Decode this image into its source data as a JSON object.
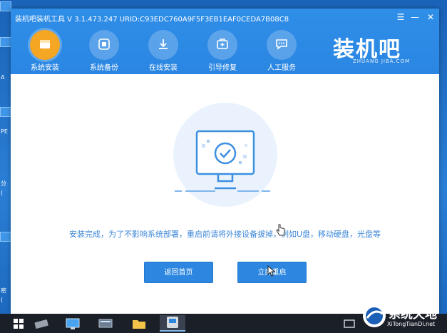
{
  "window": {
    "title": "装机吧装机工具 V 3.1.473.247 URID:C93EDC760A9F5F3EB1EAF0CEDA7B08C8",
    "controls": {
      "menu": "☰",
      "minimize": "—",
      "close": "✕"
    }
  },
  "nav": {
    "items": [
      {
        "label": "系统安装",
        "icon": "system-install-icon",
        "active": true
      },
      {
        "label": "系统备份",
        "icon": "system-backup-icon",
        "active": false
      },
      {
        "label": "在线安装",
        "icon": "online-install-icon",
        "active": false
      },
      {
        "label": "引导修复",
        "icon": "boot-repair-icon",
        "active": false
      },
      {
        "label": "人工服务",
        "icon": "manual-service-icon",
        "active": false
      }
    ]
  },
  "logo": {
    "cn": "装机吧",
    "en": "ZHUANG JIBA.COM"
  },
  "content": {
    "message": "安装完成，为了不影响系统部署，重启前请将外接设备拔掉，例如U盘，移动硬盘，光盘等",
    "buttons": {
      "home": "返回首页",
      "reboot": "立即重启"
    }
  },
  "desktop": {
    "labels": [
      "A",
      "PE",
      "分",
      "(",
      "密",
      "("
    ]
  },
  "watermark": {
    "cn": "系统天地",
    "en": "XiTongTianDi.net"
  },
  "colors": {
    "accent": "#2d87e0",
    "titlebar": "#2f8ee8",
    "message": "#3a86d8",
    "active_nav": "#f5a623"
  }
}
